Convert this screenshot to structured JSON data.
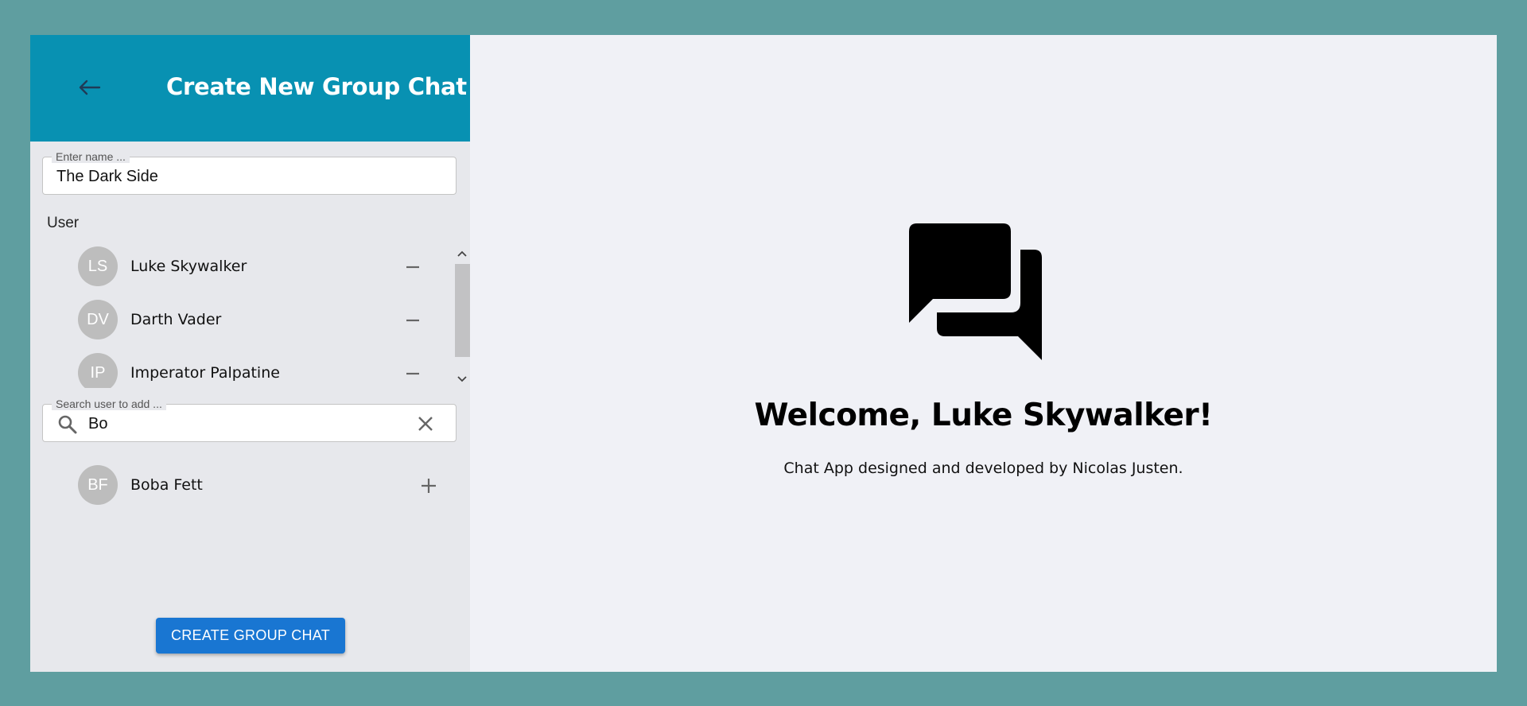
{
  "sidebar": {
    "header": {
      "title": "Create New Group Chat",
      "back_icon": "arrow-left-icon",
      "background": "#0891b2"
    },
    "name_field": {
      "label": "Enter name ...",
      "value": "The Dark Side"
    },
    "users_label": "User",
    "selected_users": [
      {
        "initials": "LS",
        "name": "Luke Skywalker",
        "action_icon": "minus-icon"
      },
      {
        "initials": "DV",
        "name": "Darth Vader",
        "action_icon": "minus-icon"
      },
      {
        "initials": "IP",
        "name": "Imperator Palpatine",
        "action_icon": "minus-icon"
      }
    ],
    "search_field": {
      "label": "Search user to add ...",
      "value": "Bo",
      "icon": "search-icon",
      "clear_icon": "close-icon"
    },
    "search_results": [
      {
        "initials": "BF",
        "name": "Boba Fett",
        "action_icon": "plus-icon"
      }
    ],
    "create_button": "CREATE GROUP CHAT",
    "accent": "#1976d2"
  },
  "main": {
    "icon": "forum-icon",
    "welcome": "Welcome, Luke Skywalker!",
    "credit": "Chat App designed and developed by Nicolas Justen."
  }
}
